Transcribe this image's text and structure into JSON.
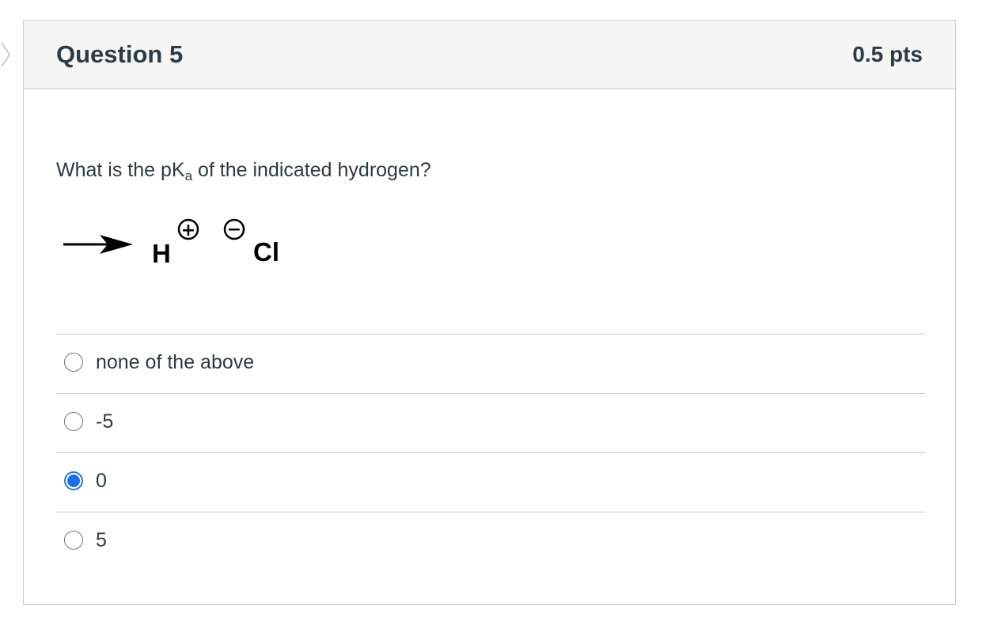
{
  "question": {
    "title": "Question 5",
    "points": "0.5 pts",
    "text_main": "What is the pK",
    "text_sub": "a",
    "text_rest": " of the indicated hydrogen?"
  },
  "molecule": {
    "hydrogen": "H",
    "chlorine": "Cl",
    "plus_charge": "+",
    "minus_charge": "−"
  },
  "answers": [
    {
      "label": "none of the above",
      "selected": false
    },
    {
      "label": "-5",
      "selected": false
    },
    {
      "label": "0",
      "selected": true
    },
    {
      "label": "5",
      "selected": false
    }
  ],
  "colors": {
    "header_bg": "#f5f5f5",
    "border": "#c7cdd1",
    "text": "#2d3b45",
    "radio_selected": "#1f6fe0"
  }
}
